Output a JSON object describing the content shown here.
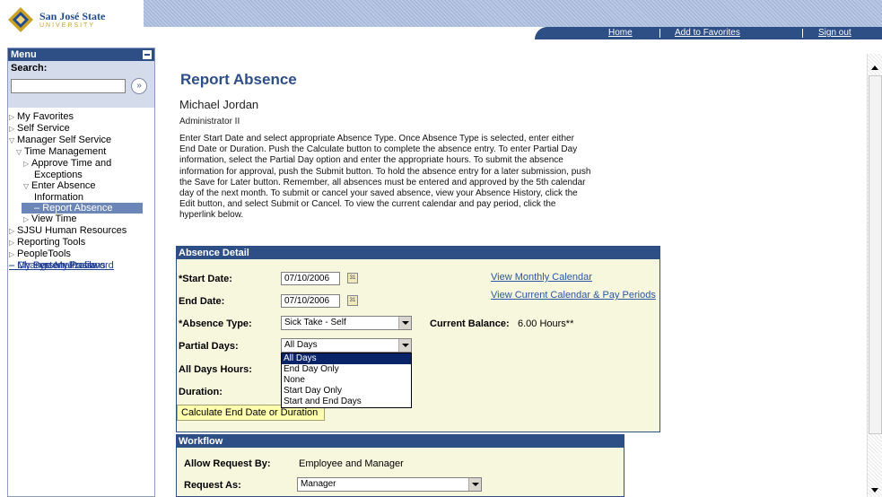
{
  "header": {
    "logo_line1": "San José State",
    "logo_line2": "UNIVERSITY",
    "nav": {
      "home": "Home",
      "favorites": "Add to Favorites",
      "signout": "Sign out"
    }
  },
  "sidebar": {
    "title": "Menu",
    "search_label": "Search:",
    "search_value": "",
    "search_go": "»",
    "items": [
      {
        "label": "My Favorites"
      },
      {
        "label": "Self Service"
      },
      {
        "label": "Manager Self Service"
      },
      {
        "label": "Time Management"
      },
      {
        "label": "Approve Time and"
      },
      {
        "label": "Exceptions"
      },
      {
        "label": "Enter Absence"
      },
      {
        "label": "Information"
      },
      {
        "label": "Report Absence"
      },
      {
        "label": "View Time"
      },
      {
        "label": "SJSU Human Resources"
      },
      {
        "label": "Reporting Tools"
      },
      {
        "label": "PeopleTools"
      },
      {
        "label": "Change My Password"
      },
      {
        "label": "My Personalizations"
      },
      {
        "label": "My System Profile"
      }
    ]
  },
  "main": {
    "title": "Report Absence",
    "name": "Michael Jordan",
    "role": "Administrator II",
    "instructions": "Enter Start Date and select appropriate Absence Type. Once Absence Type is selected, enter either End Date or Duration. Push the Calculate button to complete the absence entry. To enter Partial Day information, select the Partial Day option and enter the appropriate hours. To submit the absence information for approval, push the Submit button. To hold the absence entry for a later submission, push the Save for Later button. Remember, all absences must be entered and approved by the 5th calendar day of the next month. To submit or cancel your saved absence, view your Absence History, click the Edit button, and select Submit or Cancel. To view the current calendar and pay period, click the hyperlink below."
  },
  "absence": {
    "header": "Absence Detail",
    "start_label": "Start Date:",
    "start_value": "07/10/2006",
    "end_label": "End Date:",
    "end_value": "07/10/2006",
    "type_label": "Absence Type:",
    "type_value": "Sick Take - Self",
    "balance_label": "Current Balance:",
    "balance_value": "6.00 Hours**",
    "partial_label": "Partial Days:",
    "partial_value": "All Days",
    "alldays_label": "All Days Hours:",
    "duration_label": "Duration:",
    "calc_label": "Calculate End Date or Duration",
    "link_monthly": "View Monthly Calendar",
    "link_current": "View Current Calendar & Pay Periods",
    "required_mark": "*",
    "options": [
      "All Days",
      "End Day Only",
      "None",
      "Start Day Only",
      "Start and End Days"
    ],
    "selected_option": "All Days"
  },
  "workflow": {
    "header": "Workflow",
    "allow_label": "Allow Request By:",
    "allow_value": "Employee and Manager",
    "request_label": "Request As:",
    "request_value": "Manager"
  },
  "colors": {
    "brand": "#2e4e86",
    "title": "#2e4e86",
    "link": "#2a56a4",
    "panel_bg": "#f7f7de",
    "highlight": "#0a246a"
  }
}
